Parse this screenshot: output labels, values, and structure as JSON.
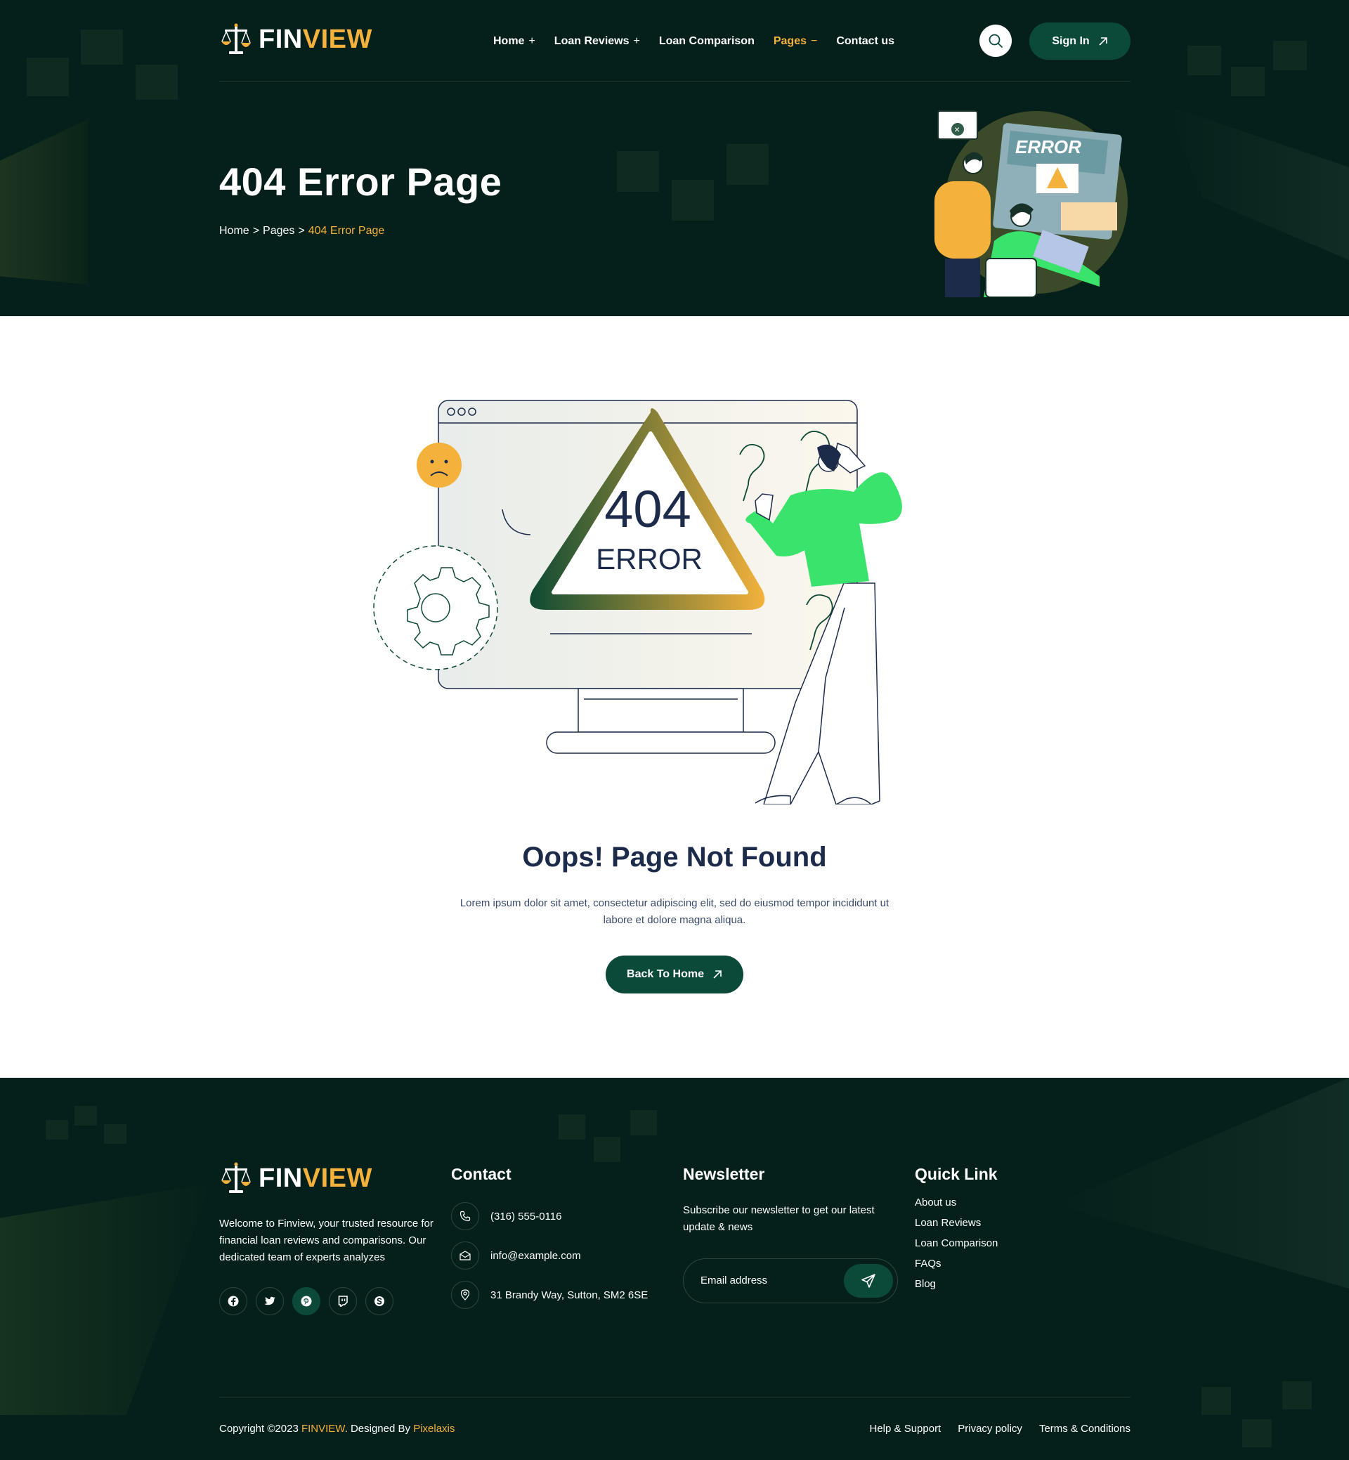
{
  "brand": {
    "name_part1": "FIN",
    "name_part2": "VIEW"
  },
  "nav": {
    "items": [
      {
        "label": "Home",
        "marker": "+"
      },
      {
        "label": "Loan Reviews",
        "marker": "+"
      },
      {
        "label": "Loan Comparison",
        "marker": ""
      },
      {
        "label": "Pages",
        "marker": "−"
      },
      {
        "label": "Contact us",
        "marker": ""
      }
    ],
    "signin_label": "Sign In"
  },
  "hero": {
    "title": "404 Error Page",
    "breadcrumb": [
      "Home",
      "Pages",
      "404 Error Page"
    ],
    "breadcrumb_sep": ">",
    "illustration_text": "ERROR"
  },
  "main": {
    "illustration_code": "404",
    "illustration_word": "ERROR",
    "heading": "Oops! Page Not Found",
    "text": "Lorem ipsum dolor sit amet, consectetur adipiscing elit, sed do eiusmod tempor incididunt ut labore et dolore magna aliqua.",
    "button_label": "Back To Home"
  },
  "footer": {
    "about": "Welcome to Finview, your trusted resource for financial loan reviews and comparisons. Our dedicated team of experts analyzes",
    "socials": [
      "facebook-icon",
      "twitter-icon",
      "pinterest-icon",
      "twitch-icon",
      "skype-icon"
    ],
    "contact": {
      "title": "Contact",
      "phone": "(316) 555-0116",
      "email": "info@example.com",
      "address": "31 Brandy Way, Sutton, SM2 6SE"
    },
    "newsletter": {
      "title": "Newsletter",
      "text": "Subscribe our newsletter to get our latest update & news",
      "placeholder": "Email address"
    },
    "quick_links": {
      "title": "Quick Link",
      "items": [
        "About us",
        "Loan Reviews",
        "Loan Comparison",
        "FAQs",
        "Blog"
      ]
    },
    "copyright_prefix": "Copyright ©2023 ",
    "copyright_brand": "FINVIEW",
    "copyright_mid": ". Designed By ",
    "copyright_designer": "Pixelaxis",
    "legal": [
      "Help & Support",
      "Privacy policy",
      "Terms & Conditions"
    ]
  },
  "colors": {
    "dark_green": "#05201a",
    "button_green": "#0b4a39",
    "gold": "#f4b23c",
    "bright_green": "#3ae36b",
    "navy": "#1d2b4a"
  }
}
